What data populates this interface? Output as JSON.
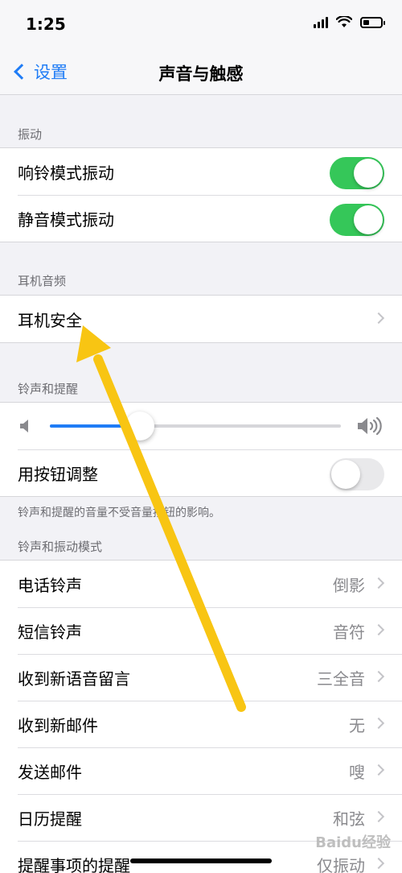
{
  "status": {
    "time": "1:25"
  },
  "nav": {
    "back_label": "设置",
    "title": "声音与触感"
  },
  "sections": {
    "vibration": {
      "header": "振动",
      "rows": [
        {
          "label": "响铃模式振动",
          "on": true
        },
        {
          "label": "静音模式振动",
          "on": true
        }
      ]
    },
    "headphone": {
      "header": "耳机音频",
      "rows": [
        {
          "label": "耳机安全"
        }
      ]
    },
    "ringer": {
      "header": "铃声和提醒",
      "volume_fraction": 0.31,
      "button_adjust": {
        "label": "用按钮调整",
        "on": false
      },
      "footnote": "铃声和提醒的音量不受音量按钮的影响。"
    },
    "patterns": {
      "header": "铃声和振动模式",
      "rows": [
        {
          "label": "电话铃声",
          "value": "倒影"
        },
        {
          "label": "短信铃声",
          "value": "音符"
        },
        {
          "label": "收到新语音留言",
          "value": "三全音"
        },
        {
          "label": "收到新邮件",
          "value": "无"
        },
        {
          "label": "发送邮件",
          "value": "嗖"
        },
        {
          "label": "日历提醒",
          "value": "和弦"
        },
        {
          "label": "提醒事项的提醒",
          "value": "仅振动"
        }
      ]
    }
  },
  "colors": {
    "accent": "#1f7cf6",
    "toggle_on": "#35c759",
    "annotation_arrow": "#f8c513"
  },
  "watermark": "Baidu经验"
}
